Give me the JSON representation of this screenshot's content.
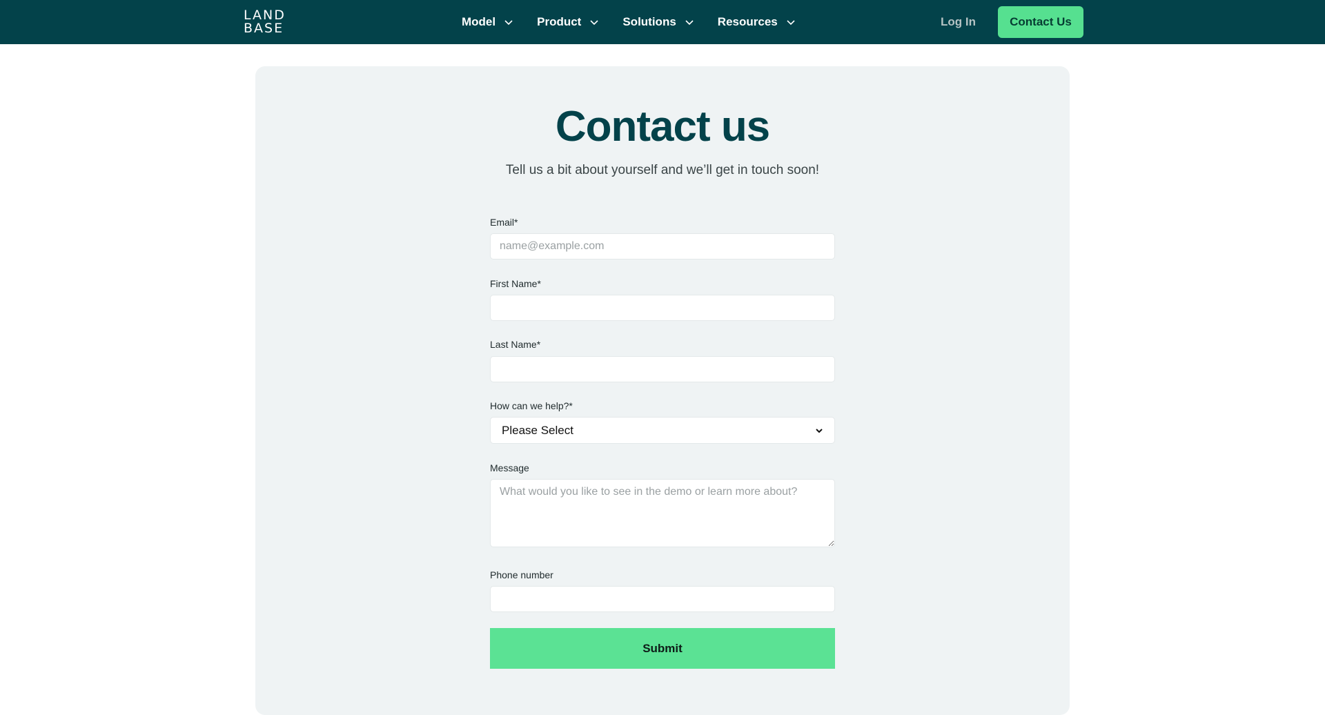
{
  "nav": {
    "logo_top": "LAND",
    "logo_bottom": "BASE",
    "menu": [
      {
        "label": "Model"
      },
      {
        "label": "Product"
      },
      {
        "label": "Solutions"
      },
      {
        "label": "Resources"
      }
    ],
    "login_label": "Log In",
    "cta_label": "Contact Us"
  },
  "colors": {
    "nav_bg": "#03424a",
    "accent": "#56e090",
    "card_bg": "#eff3f4",
    "title": "#03424a"
  },
  "page": {
    "title": "Contact us",
    "subtitle": "Tell us a bit about yourself and we’ll get in touch soon!"
  },
  "form": {
    "email": {
      "label": "Email*",
      "placeholder": "name@example.com",
      "value": ""
    },
    "first_name": {
      "label": "First Name*",
      "value": ""
    },
    "last_name": {
      "label": "Last Name*",
      "value": ""
    },
    "help": {
      "label": "How can we help?*",
      "selected": "Please Select"
    },
    "message": {
      "label": "Message",
      "placeholder": "What would you like to see in the demo or learn more about?"
    },
    "phone": {
      "label": "Phone number",
      "value": ""
    },
    "submit_label": "Submit"
  }
}
